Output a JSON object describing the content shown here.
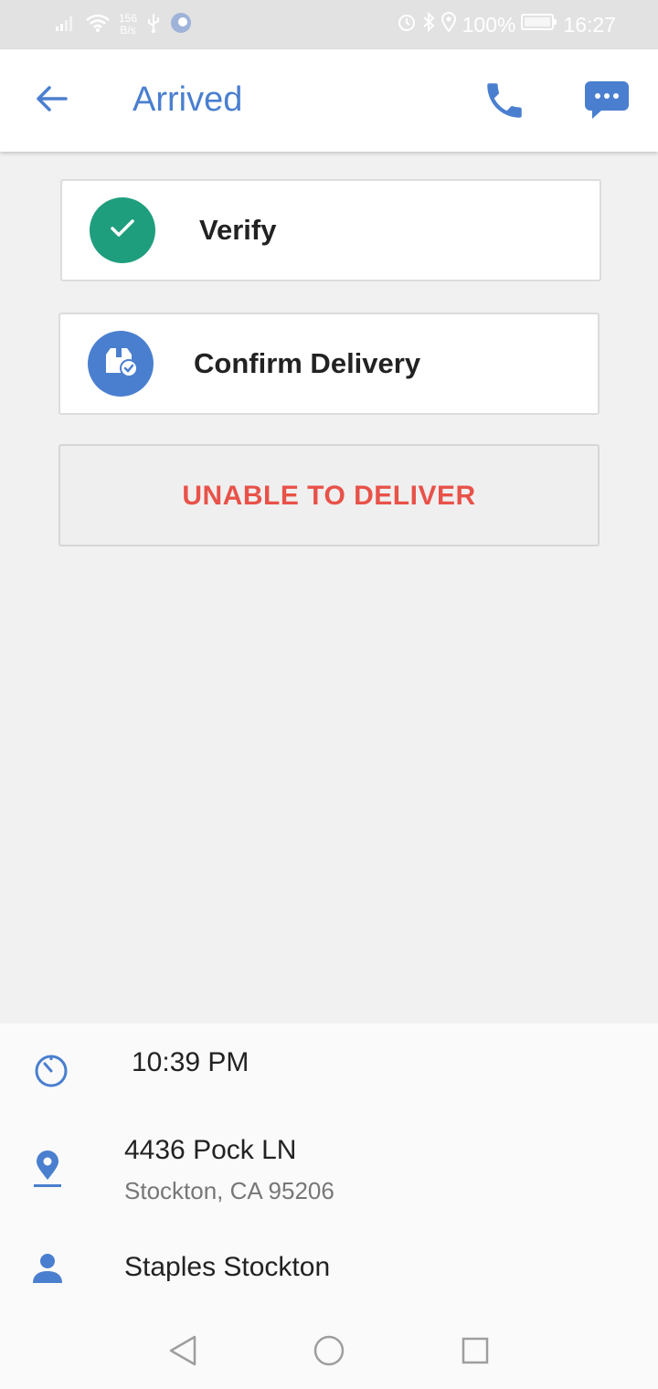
{
  "status_bar": {
    "net_speed_value": "156",
    "net_speed_unit": "B/s",
    "battery_percent": "100%",
    "time": "16:27"
  },
  "app_bar": {
    "title": "Arrived",
    "icons": {
      "back": "arrow-left-icon",
      "call": "phone-icon",
      "chat": "chat-bubble-icon"
    }
  },
  "actions": {
    "verify_label": "Verify",
    "confirm_label": "Confirm Delivery",
    "unable_label": "UNABLE TO DELIVER"
  },
  "details": {
    "time": "10:39 PM",
    "address_line1": "4436 Pock LN",
    "address_line2": "Stockton, CA 95206",
    "customer": "Staples Stockton"
  },
  "colors": {
    "accent_blue": "#4a7fcf",
    "verify_green": "#1f9e7d",
    "danger_red": "#e85249"
  }
}
